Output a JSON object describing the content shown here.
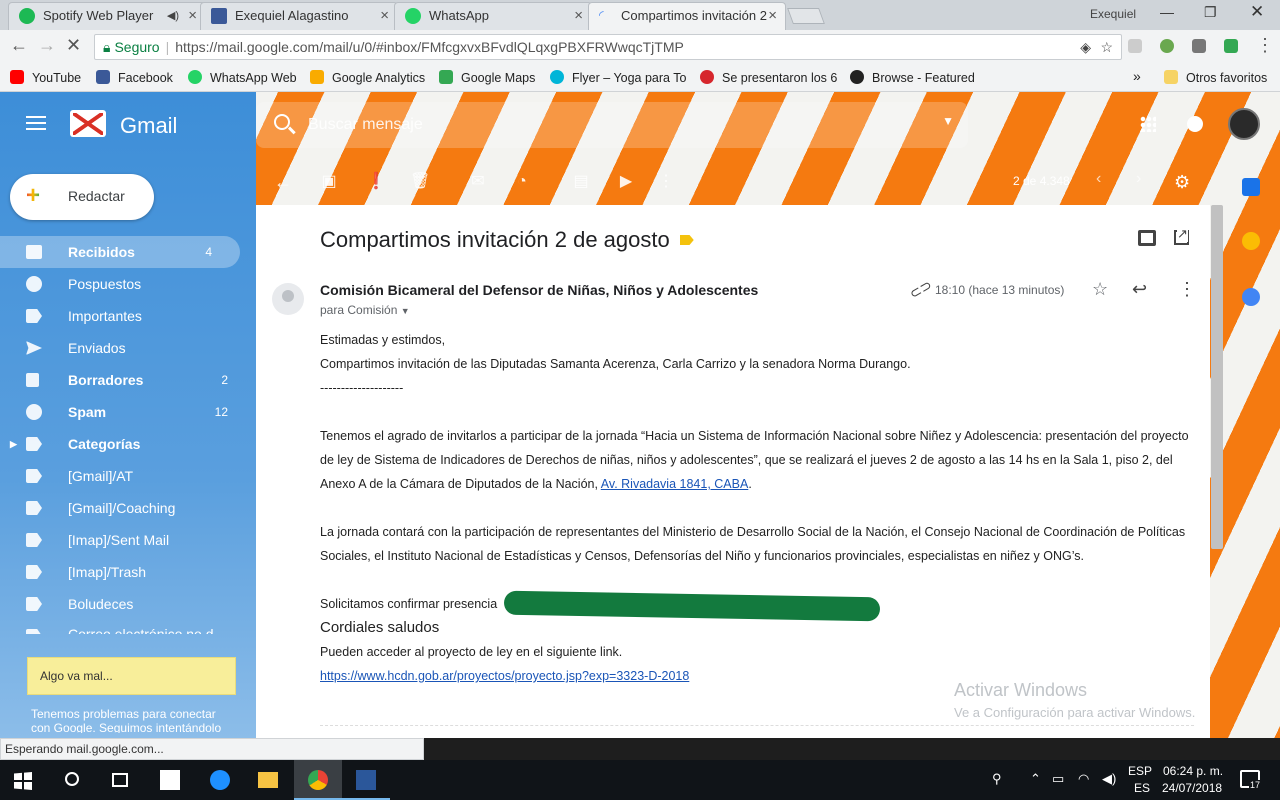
{
  "browser": {
    "tabs": [
      {
        "label": "Spotify Web Player",
        "favicon_color": "#1db954",
        "has_audio": true
      },
      {
        "label": "Exequiel Alagastino",
        "favicon_color": "#3b5998"
      },
      {
        "label": "WhatsApp",
        "favicon_color": "#25d366"
      },
      {
        "label": "Compartimos invitación 2",
        "favicon_color": "#4285f4",
        "active": true
      }
    ],
    "window_user": "Exequiel",
    "address": {
      "secure_label": "Seguro",
      "url": "https://mail.google.com/mail/u/0/#inbox/FMfcgxvxBFvdlQLqxgPBXFRWwqcTjTMP"
    },
    "bookmarks": [
      {
        "label": "YouTube",
        "color": "#ff0000"
      },
      {
        "label": "Facebook",
        "color": "#3b5998"
      },
      {
        "label": "WhatsApp Web",
        "color": "#25d366"
      },
      {
        "label": "Google Analytics",
        "color": "#f9ab00"
      },
      {
        "label": "Google Maps",
        "color": "#34a853"
      },
      {
        "label": "Flyer – Yoga para To",
        "color": "#00b5d8"
      },
      {
        "label": "Se presentaron los 6",
        "color": "#d6262d"
      },
      {
        "label": "Browse - Featured",
        "color": "#222222"
      }
    ],
    "bookmarks_overflow": "»",
    "other_bookmarks": "Otros favoritos"
  },
  "gmail": {
    "brand": "Gmail",
    "search_placeholder": "Buscar mensaje",
    "compose_label": "Redactar",
    "nav": [
      {
        "label": "Recibidos",
        "count": "4",
        "icon": "inbox-icon",
        "active": true
      },
      {
        "label": "Pospuestos",
        "count": "",
        "icon": "clock-icon"
      },
      {
        "label": "Importantes",
        "count": "",
        "icon": "important-icon"
      },
      {
        "label": "Enviados",
        "count": "",
        "icon": "send-icon"
      },
      {
        "label": "Borradores",
        "count": "2",
        "icon": "draft-icon",
        "bold": true
      },
      {
        "label": "Spam",
        "count": "12",
        "icon": "spam-icon",
        "bold": true
      },
      {
        "label": "Categorías",
        "count": "",
        "icon": "label-icon",
        "bold": true,
        "expandable": true
      },
      {
        "label": "[Gmail]/AT",
        "count": "",
        "icon": "label-icon"
      },
      {
        "label": "[Gmail]/Coaching",
        "count": "",
        "icon": "label-icon"
      },
      {
        "label": "[Imap]/Sent Mail",
        "count": "",
        "icon": "label-icon"
      },
      {
        "label": "[Imap]/Trash",
        "count": "",
        "icon": "label-icon"
      },
      {
        "label": "Boludeces",
        "count": "",
        "icon": "label-icon"
      },
      {
        "label": "Correo electrónico no d",
        "count": "",
        "icon": "label-icon"
      }
    ],
    "warning_box": "Algo va mal...",
    "warning_text": "Tenemos problemas para conectar con Google. Seguimos intentándolo",
    "pager": "2 de 4.348",
    "message": {
      "subject": "Compartimos invitación 2 de agosto",
      "sender": "Comisión Bicameral del Defensor de Niñas, Niños y Adolescentes",
      "recipient": "para Comisión",
      "time": "18:10 (hace 13 minutos)",
      "greeting": "Estimadas y estimdos,",
      "intro": "Compartimos invitación de las Diputadas Samanta Acerenza, Carla Carrizo y la senadora Norma Durango.",
      "divider": "--------------------",
      "para1": "Tenemos el agrado de invitarlos a participar de la jornada “Hacia un Sistema de Información Nacional sobre Niñez y Adolescencia: presentación del proyecto de ley de Sistema de Indicadores de Derechos de niñas, niños y adolescentes”, que se realizará el jueves 2 de agosto a las 14 hs en la Sala 1, piso 2, del Anexo A de la Cámara de Diputados de la Nación,",
      "address_link": "Av. Rivadavia 1841, CABA",
      "para2": "La jornada contará con la participación de representantes del Ministerio de Desarrollo Social de la Nación, el Consejo Nacional de Coordinación de Políticas Sociales, el Instituto Nacional de Estadísticas y Censos, Defensorías del Niño y funcionarios provinciales, especialistas en niñez y ONG’s.",
      "confirm": "Solicitamos confirmar presencia",
      "closing": "Cordiales saludos",
      "link_intro": "Pueden acceder al proyecto de ley en el siguiente link.",
      "link": "https://www.hcdn.gob.ar/proyectos/proyecto.jsp?exp=3323-D-2018"
    }
  },
  "windows": {
    "activate_title": "Activar Windows",
    "activate_sub": "Ve a Configuración para activar Windows.",
    "status": "Esperando mail.google.com...",
    "lang_top": "ESP",
    "lang_bottom": "ES",
    "time": "06:24 p. m.",
    "date": "24/07/2018",
    "notifications": "17"
  }
}
